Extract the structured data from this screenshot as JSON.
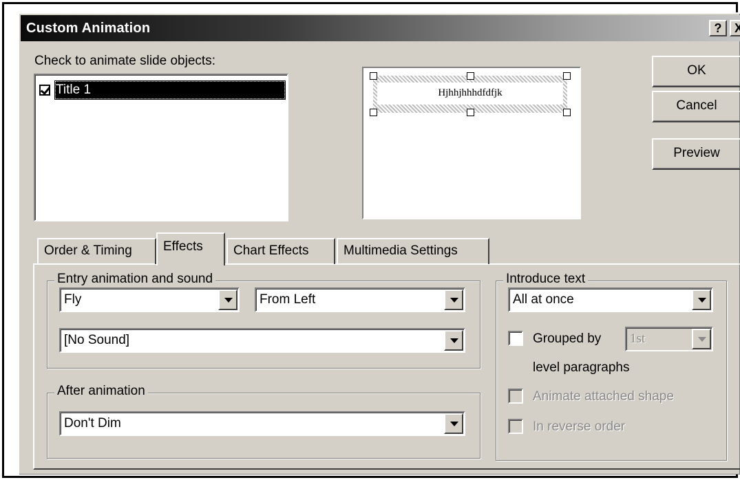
{
  "window": {
    "title": "Custom Animation",
    "help_label": "?",
    "close_label": "X"
  },
  "objects": {
    "label": "Check to animate slide objects:",
    "items": [
      {
        "label": "Title 1",
        "checked": true,
        "selected": true
      }
    ]
  },
  "preview": {
    "slide_text": "Hjhhjhhhdfdfjk"
  },
  "buttons": {
    "ok": "OK",
    "cancel": "Cancel",
    "preview": "Preview"
  },
  "tabs": [
    {
      "label": "Order & Timing",
      "active": false
    },
    {
      "label": "Effects",
      "active": true
    },
    {
      "label": "Chart Effects",
      "active": false
    },
    {
      "label": "Multimedia Settings",
      "active": false
    }
  ],
  "entry": {
    "group_title": "Entry animation and sound",
    "effect": "Fly",
    "direction": "From Left",
    "sound": "[No Sound]"
  },
  "after": {
    "group_title": "After animation",
    "value": "Don't Dim"
  },
  "introduce": {
    "group_title": "Introduce text",
    "value": "All at once",
    "grouped_by_label": "Grouped by",
    "grouped_by_value": "1st",
    "level_label": "level paragraphs",
    "animate_shape_label": "Animate attached shape",
    "reverse_label": "In reverse order"
  }
}
